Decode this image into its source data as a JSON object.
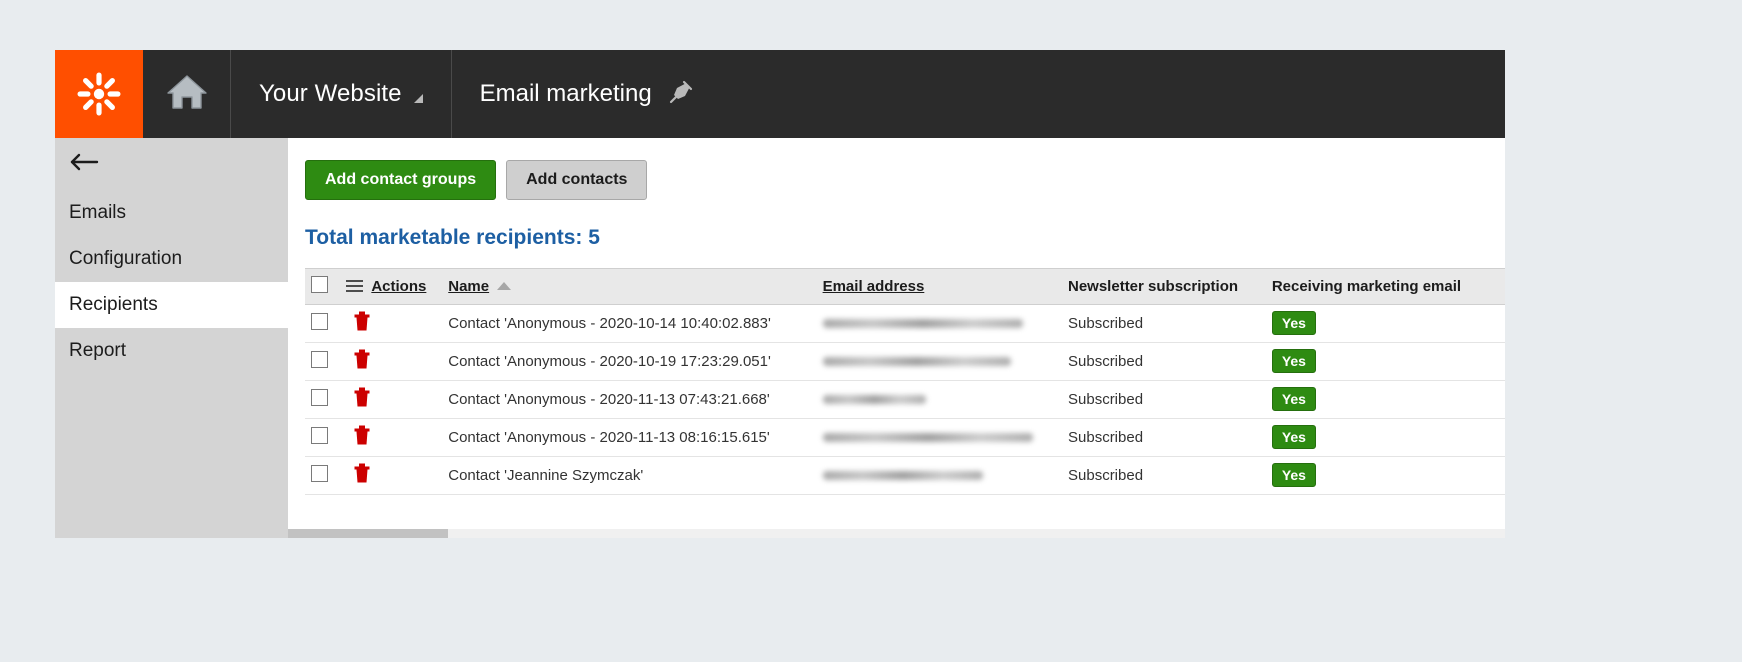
{
  "header": {
    "logo_icon": "kentico-flower-logo",
    "home_icon": "home-icon",
    "site_name": "Your Website",
    "site_caret_icon": "caret-down-icon",
    "app_name": "Email marketing",
    "pin_icon": "pin-icon"
  },
  "sidebar": {
    "back_icon": "back-arrow-icon",
    "items": [
      {
        "label": "Emails",
        "active": false
      },
      {
        "label": "Configuration",
        "active": false
      },
      {
        "label": "Recipients",
        "active": true
      },
      {
        "label": "Report",
        "active": false
      }
    ]
  },
  "toolbar": {
    "add_contact_groups_label": "Add contact groups",
    "add_contacts_label": "Add contacts"
  },
  "main": {
    "total_heading": "Total marketable recipients: 5",
    "table": {
      "select_all_icon": "checkbox-icon",
      "column_menu_icon": "hamburger-menu-icon",
      "sort_indicator_icon": "sort-ascending-icon",
      "columns": [
        "Actions",
        "Name",
        "Email address",
        "Newsletter subscription",
        "Receiving marketing email"
      ],
      "row_checkbox_icon": "checkbox-icon",
      "row_delete_icon": "trash-icon",
      "rows": [
        {
          "name": "Contact 'Anonymous - 2020-10-14 10:40:02.883'",
          "email_redacted_width": 200,
          "newsletter_subscription": "Subscribed",
          "receiving_marketing_email": "Yes"
        },
        {
          "name": "Contact 'Anonymous - 2020-10-19 17:23:29.051'",
          "email_redacted_width": 188,
          "newsletter_subscription": "Subscribed",
          "receiving_marketing_email": "Yes"
        },
        {
          "name": "Contact 'Anonymous - 2020-11-13 07:43:21.668'",
          "email_redacted_width": 103,
          "newsletter_subscription": "Subscribed",
          "receiving_marketing_email": "Yes"
        },
        {
          "name": "Contact 'Anonymous - 2020-11-13 08:16:15.615'",
          "email_redacted_width": 210,
          "newsletter_subscription": "Subscribed",
          "receiving_marketing_email": "Yes"
        },
        {
          "name": "Contact 'Jeannine Szymczak'",
          "email_redacted_width": 160,
          "newsletter_subscription": "Subscribed",
          "receiving_marketing_email": "Yes"
        }
      ]
    }
  },
  "colors": {
    "brand_orange": "#ff4f00",
    "header_dark": "#2b2b2b",
    "heading_blue": "#1d5fa3",
    "primary_green": "#2e8b12",
    "delete_red": "#cc0000"
  }
}
